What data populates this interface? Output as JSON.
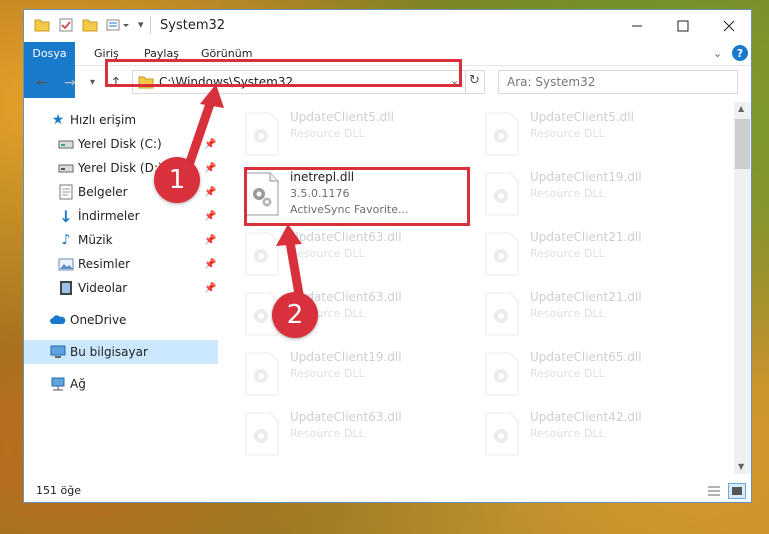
{
  "window": {
    "title": "System32"
  },
  "ribbon": {
    "tabs": [
      "Dosya",
      "Giriş",
      "Paylaş",
      "Görünüm"
    ]
  },
  "address": {
    "path": "C:\\Windows\\System32",
    "search_placeholder": "Ara: System32"
  },
  "sidebar": {
    "items": [
      {
        "label": "Hızlı erişim",
        "icon": "star-icon"
      },
      {
        "label": "Yerel Disk (C:)",
        "icon": "drive-icon",
        "pinned": true
      },
      {
        "label": "Yerel Disk (D:)",
        "icon": "drive-icon",
        "pinned": true
      },
      {
        "label": "Belgeler",
        "icon": "documents-icon",
        "pinned": true
      },
      {
        "label": "İndirmeler",
        "icon": "download-icon",
        "pinned": true
      },
      {
        "label": "Müzik",
        "icon": "music-icon",
        "pinned": true
      },
      {
        "label": "Resimler",
        "icon": "pictures-icon",
        "pinned": true
      },
      {
        "label": "Videolar",
        "icon": "video-icon",
        "pinned": true
      },
      {
        "label": "OneDrive",
        "icon": "cloud-icon"
      },
      {
        "label": "Bu bilgisayar",
        "icon": "computer-icon",
        "selected": true
      },
      {
        "label": "Ağ",
        "icon": "network-icon"
      }
    ]
  },
  "files": {
    "left": [
      {
        "name": "UpdateClient5.dll",
        "type": "Resource DLL"
      },
      {
        "name": "inetrepl.dll",
        "version": "3.5.0.1176",
        "description": "ActiveSync Favorite..."
      },
      {
        "name": "UpdateClient63.dll",
        "type": "Resource DLL"
      },
      {
        "name": "UpdateClient63.dll",
        "type": "Resource DLL"
      },
      {
        "name": "UpdateClient19.dll",
        "type": "Resource DLL"
      },
      {
        "name": "UpdateClient63.dll",
        "type": "Resource DLL"
      }
    ],
    "right": [
      {
        "name": "UpdateClient5.dll",
        "type": "Resource DLL"
      },
      {
        "name": "UpdateClient19.dll",
        "type": "Resource DLL"
      },
      {
        "name": "UpdateClient21.dll",
        "type": "Resource DLL"
      },
      {
        "name": "UpdateClient21.dll",
        "type": "Resource DLL"
      },
      {
        "name": "UpdateClient65.dll",
        "type": "Resource DLL"
      },
      {
        "name": "UpdateClient42.dll",
        "type": "Resource DLL"
      }
    ]
  },
  "status": {
    "count": "151 öğe"
  },
  "annotations": {
    "step1": "1",
    "step2": "2",
    "color": "#d9313c"
  }
}
